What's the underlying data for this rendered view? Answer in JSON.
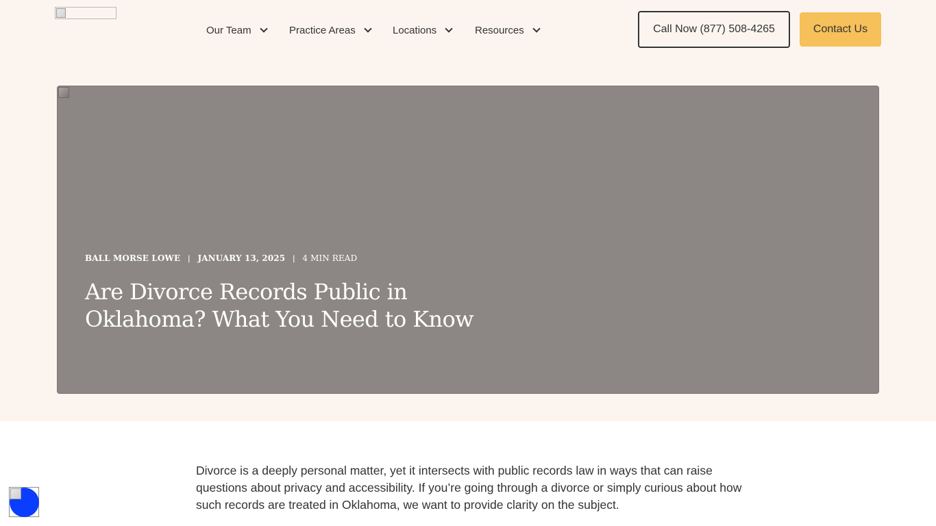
{
  "header": {
    "logo_icon": "broken-image-icon",
    "nav": [
      {
        "label": "Our Team",
        "icon": "chevron-down-icon"
      },
      {
        "label": "Practice Areas",
        "icon": "chevron-down-icon"
      },
      {
        "label": "Locations",
        "icon": "chevron-down-icon"
      },
      {
        "label": "Resources",
        "icon": "chevron-down-icon"
      }
    ],
    "call_button": "Call Now (877) 508-4265",
    "contact_button": "Contact Us"
  },
  "hero": {
    "image_icon": "broken-image-icon",
    "author": "BALL MORSE LOWE",
    "separator": "|",
    "date": "JANUARY 13, 2025",
    "read_time": "4 MIN READ",
    "title": "Are Divorce Records Public in Oklahoma? What You Need to Know"
  },
  "article": {
    "intro": "Divorce is a deeply personal matter, yet it intersects with public records law in ways that can raise questions about privacy and accessibility. If you’re going through a divorce or simply curious about how such records are treated in Oklahoma, we want to provide clarity on the subject."
  },
  "accessibility_widget": {
    "icon": "accessibility-icon"
  },
  "colors": {
    "page_background": "#fcf5ef",
    "hero_background": "#8c8785",
    "accent": "#f6c05a",
    "text": "#333333",
    "accessibility_blue": "#0b3dff"
  }
}
